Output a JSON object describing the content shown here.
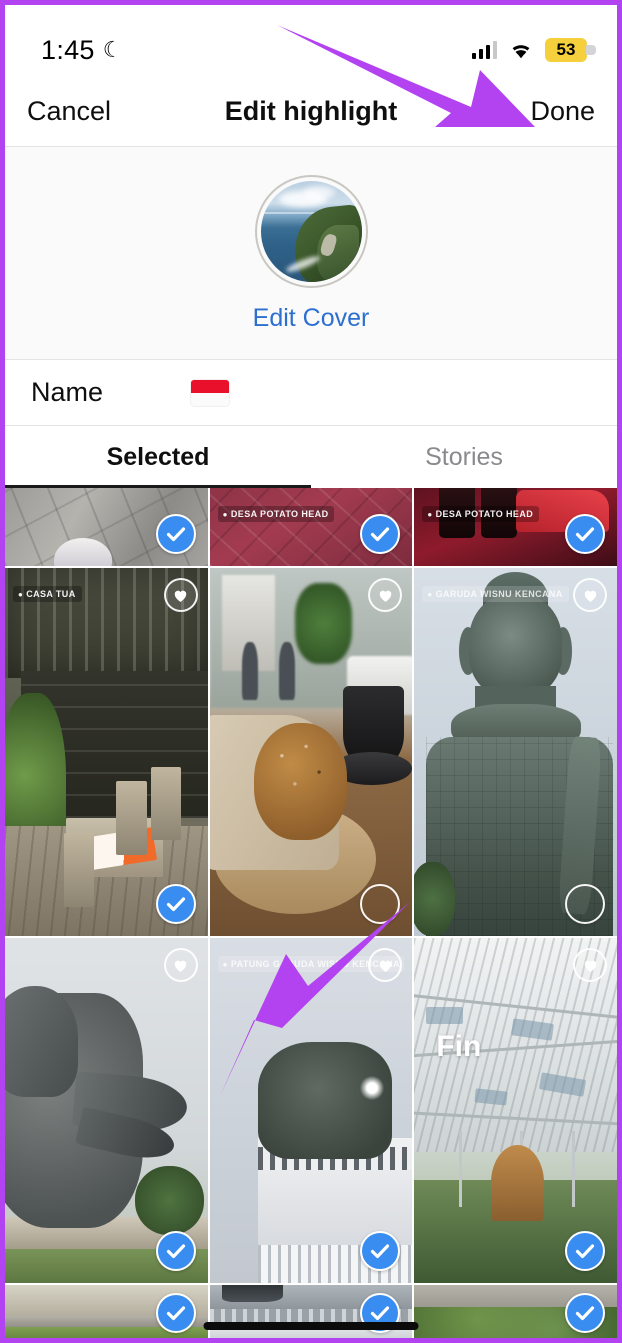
{
  "status_bar": {
    "time": "1:45",
    "moon_icon": "crescent-moon",
    "do_not_disturb": true,
    "cellular_icon": "cellular-signal",
    "cellular_bars": 3,
    "wifi_icon": "wifi",
    "battery_level": "53",
    "battery_low_power_color": "#f5d03c"
  },
  "navbar": {
    "cancel_label": "Cancel",
    "title": "Edit highlight",
    "done_label": "Done",
    "done_arrow_color": "#b342f0"
  },
  "cover": {
    "edit_cover_label": "Edit Cover",
    "edit_cover_color": "#2d6fd0",
    "cover_image_alt": "coastal-cliff-photo"
  },
  "name_row": {
    "label": "Name",
    "value": "🇮🇩",
    "value_description": "indonesia-flag"
  },
  "tabs": [
    {
      "label": "Selected",
      "active": true
    },
    {
      "label": "Stories",
      "active": false
    }
  ],
  "grid": {
    "rows": [
      {
        "row": 1,
        "cells": [
          {
            "art": "ph-pavement",
            "location": "",
            "selected": true,
            "heart": false,
            "text": ""
          },
          {
            "art": "ph-redtile",
            "location": "DESA POTATO HEAD",
            "selected": true,
            "heart": false,
            "text": ""
          },
          {
            "art": "ph-redbar",
            "location": "DESA POTATO HEAD",
            "selected": true,
            "heart": false,
            "text": ""
          }
        ]
      },
      {
        "row": 2,
        "cells": [
          {
            "art": "ph-cafe",
            "location": "CASA TUA",
            "selected": true,
            "heart": true,
            "text": ""
          },
          {
            "art": "ph-bagel",
            "location": "",
            "selected": false,
            "heart": true,
            "text": ""
          },
          {
            "art": "ph-gwk",
            "location": "GARUDA WISNU KENCANA",
            "location_faint": true,
            "selected": false,
            "heart": true,
            "text": ""
          }
        ]
      },
      {
        "row": 3,
        "cells": [
          {
            "art": "ph-garuda",
            "location": "",
            "selected": true,
            "heart": true,
            "text": ""
          },
          {
            "art": "ph-monument",
            "location": "PATUNG GARUDA WISNU KENCANA",
            "location_faint": true,
            "selected": true,
            "heart": true,
            "text": ""
          },
          {
            "art": "ph-airport",
            "location": "",
            "selected": true,
            "heart": true,
            "text": "Fin"
          }
        ]
      },
      {
        "row": 4,
        "cells": [
          {
            "art": "ph-grassdusk",
            "location": "",
            "selected": true,
            "heart": false,
            "text": ""
          },
          {
            "art": "ph-concrete",
            "location": "",
            "selected": true,
            "heart": false,
            "text": ""
          },
          {
            "art": "ph-garden",
            "location": "",
            "selected": true,
            "heart": false,
            "text": ""
          }
        ]
      }
    ],
    "checked_color": "#3a8df0"
  },
  "annotations": {
    "arrow_color": "#b342f0",
    "top_arrow_target": "Done",
    "bottom_arrow_target": "unselected-circle"
  },
  "frame": {
    "border_color": "#b342f0"
  }
}
